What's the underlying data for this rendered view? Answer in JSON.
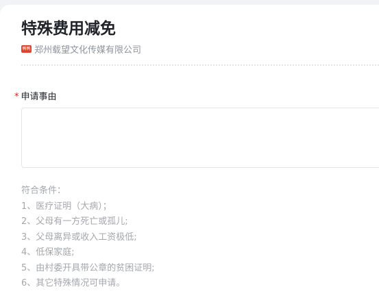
{
  "form": {
    "title": "特殊费用减免",
    "org_badge": "鸭鸭",
    "org_name": "郑州载望文化传媒有限公司"
  },
  "field": {
    "required_mark": "*",
    "label": "申请事由",
    "value": ""
  },
  "description": {
    "heading": "符合条件：",
    "items": [
      "1、医疗证明（大病）；",
      "2、父母有一方死亡或孤儿;",
      "3、父母离异或收入工资极低;",
      "4、低保家庭;",
      "5、由村委开具带公章的贫困证明;",
      "6、其它特殊情况可申请。"
    ]
  },
  "colors": {
    "page_background": "#f2f3f7",
    "card_background": "#ffffff",
    "org_badge": "#d9442c",
    "required_mark": "#e02020"
  }
}
